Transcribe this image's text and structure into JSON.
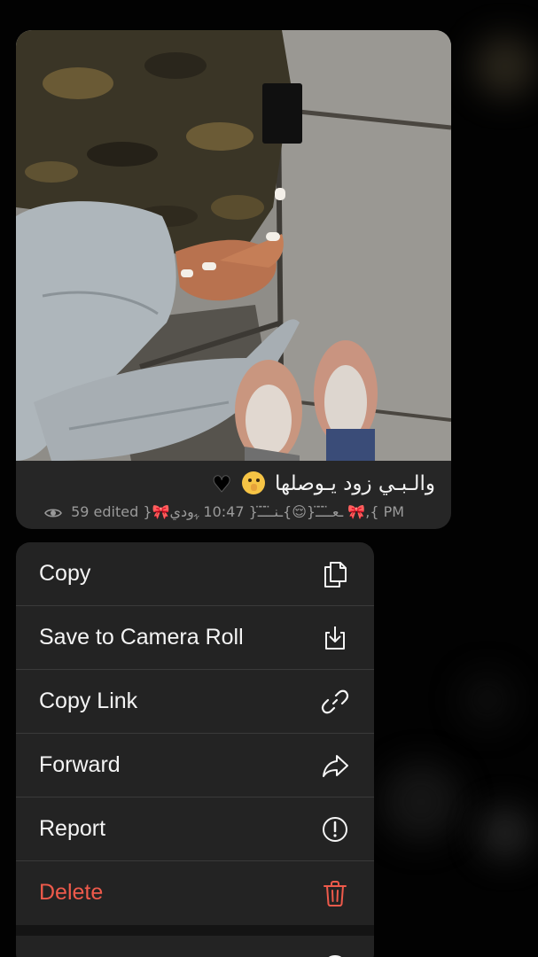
{
  "message": {
    "caption": "والـبـي زود يـوصلها",
    "views": "59",
    "edited_label": "edited",
    "signature": "}🎀ـعـ̈ـ̈ـ̈ـ{😌}ـنـ̈ـ̈ـ̈ـ{",
    "time": "10:47",
    "signature_tail": "ﮩودي 🎀,{ PM"
  },
  "menu": {
    "items": [
      {
        "label": "Copy",
        "icon": "copy-icon"
      },
      {
        "label": "Save to Camera Roll",
        "icon": "save-icon"
      },
      {
        "label": "Copy Link",
        "icon": "link-icon"
      },
      {
        "label": "Forward",
        "icon": "forward-icon"
      },
      {
        "label": "Report",
        "icon": "report-icon"
      },
      {
        "label": "Delete",
        "icon": "trash-icon"
      }
    ]
  },
  "colors": {
    "menu_background": "#232323",
    "bubble_background": "#262626",
    "danger": "#ee5a4b",
    "text": "#f4f4f4",
    "meta_text": "#9a9a9a"
  }
}
